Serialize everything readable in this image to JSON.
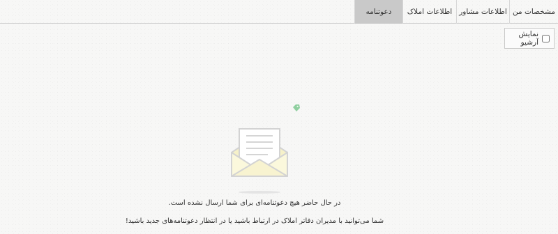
{
  "tabs": [
    {
      "label": "مشخصات من",
      "active": false
    },
    {
      "label": "اطلاعات مشاور",
      "active": false
    },
    {
      "label": "اطلاعات املاک",
      "active": false
    },
    {
      "label": "دعوتنامه",
      "active": true
    }
  ],
  "archive": {
    "label": "نمایش آرشیو",
    "checked": false
  },
  "empty_state": {
    "icon": "envelope-open-icon",
    "line1": "در حال حاضر هیچ دعوتنامه‌ای برای شما ارسال نشده است.",
    "line2": "شما می‌توانید با مدیران دفاتر املاک در ارتباط باشید یا در انتظار دعوتنامه‌های جدید باشید!"
  },
  "colors": {
    "active_tab_bg": "#c9c9c9",
    "tag_icon": "#8fcf9f",
    "envelope_stroke": "#d3d3d3",
    "envelope_fill": "#f8f4d6"
  }
}
